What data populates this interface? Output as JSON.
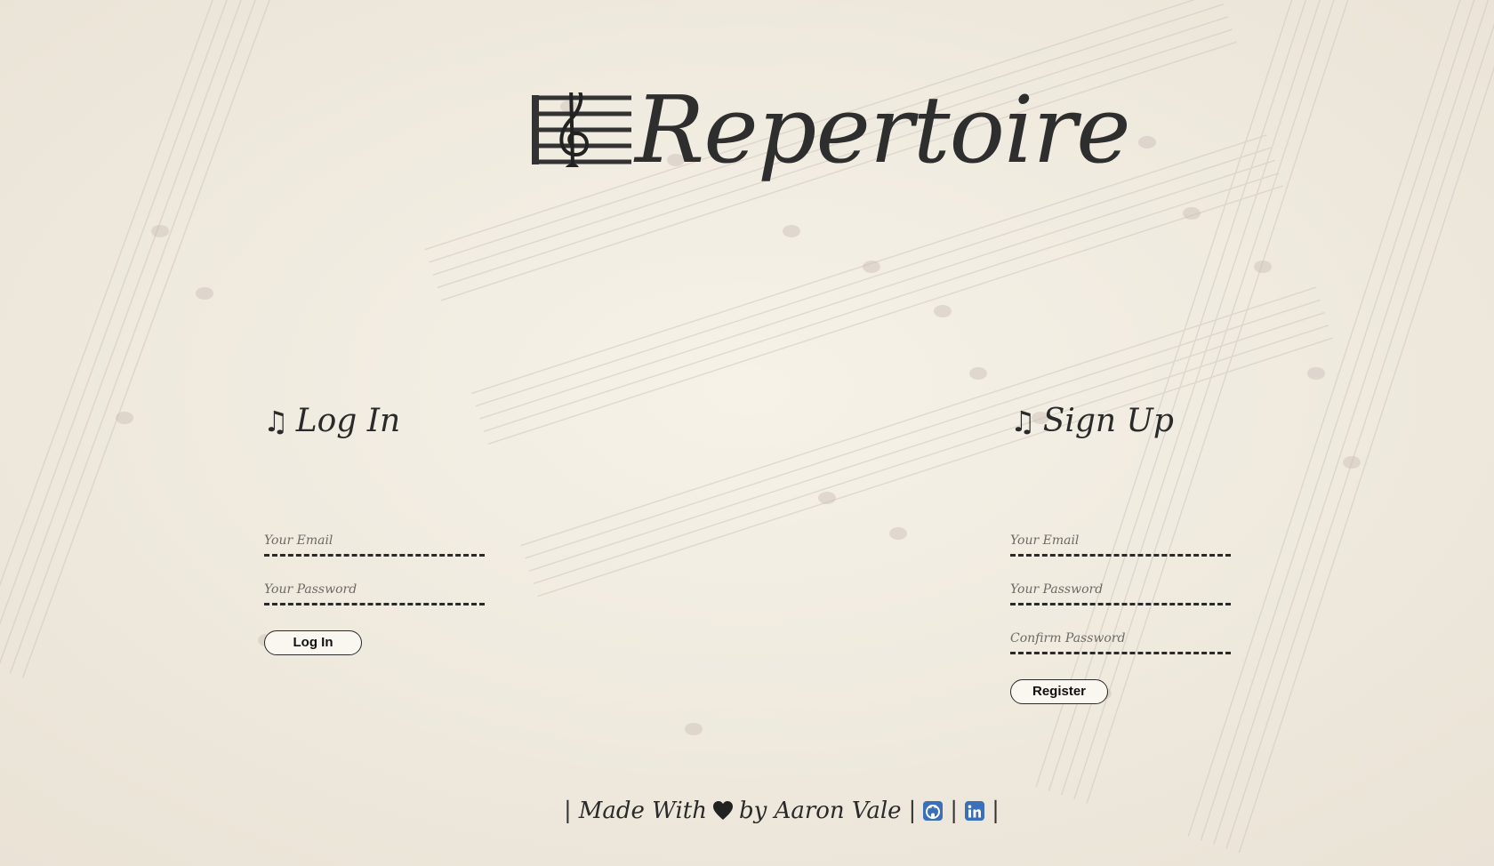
{
  "brand": {
    "name": "Repertoire"
  },
  "login": {
    "heading": "Log In",
    "heading_icon": "music-notes",
    "email_placeholder": "Your Email",
    "password_placeholder": "Your Password",
    "submit_label": "Log In"
  },
  "signup": {
    "heading": "Sign Up",
    "heading_icon": "music-notes",
    "email_placeholder": "Your Email",
    "password_placeholder": "Your Password",
    "confirm_placeholder": "Confirm Password",
    "submit_label": "Register"
  },
  "footer": {
    "made_with": "Made With",
    "by": "by Aaron Vale",
    "separator": "|",
    "heart_icon": "heart",
    "github_icon": "github",
    "linkedin_icon": "linkedin"
  },
  "colors": {
    "background": "#f1ece2",
    "text": "#2a2a2a",
    "social_icon": "#3b6fb8"
  }
}
